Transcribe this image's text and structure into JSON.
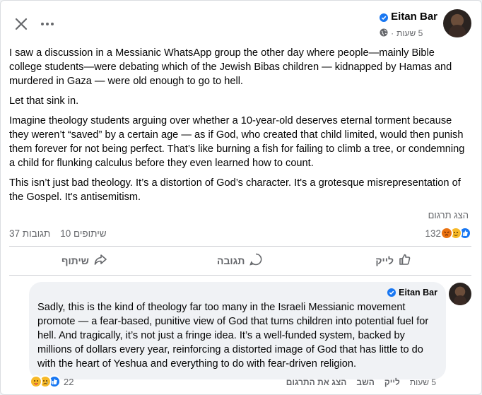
{
  "header": {
    "close_icon": "close-icon",
    "more_icon": "more-horizontal-icon",
    "author_name": "Eitan Bar",
    "time": "5 שעות",
    "separator": "·",
    "audience_icon": "globe-icon"
  },
  "post": {
    "paragraphs": [
      "I saw a discussion in a Messianic WhatsApp group the other day where people—mainly Bible college students—were debating which of the Jewish Bibas children — kidnapped by Hamas and murdered in Gaza — were old enough to go to hell.",
      "Let that sink in.",
      "Imagine theology students arguing over whether a 10-year-old deserves eternal torment because they weren’t “saved” by a certain age — as if God, who created that child limited, would then punish them forever for not being perfect. That’s like burning a fish for failing to climb a tree, or condemning a child for flunking calculus before they even learned how to count.",
      "This isn’t just bad theology. It’s a distortion of God’s character. It's a grotesque misrepresentation of the Gospel. It's antisemitism."
    ],
    "translate_label": "הצג תרגום"
  },
  "stats": {
    "reactions_count": "132",
    "comments": "37 תגובות",
    "shares": "10 שיתופים"
  },
  "actions": {
    "like_label": "לייק",
    "comment_label": "תגובה",
    "share_label": "שיתוף"
  },
  "comment": {
    "author_name": "Eitan Bar",
    "text": "Sadly, this is the kind of theology far too many in the Israeli Messianic movement promote — a fear-based, punitive view of God that turns children into potential fuel for hell. And tragically, it’s not just a fringe idea. It’s a well-funded system, backed by millions of dollars every year, reinforcing a distorted image of God that has little to do with the heart of Yeshua and everything to do with fear-driven religion.",
    "time": "5 שעות",
    "like_label": "לייק",
    "reply_label": "השב",
    "translate_label": "הצג את התרגום",
    "reactions_count": "22"
  },
  "colors": {
    "like_blue": "#1877f2",
    "care_yellow": "#f7b928",
    "angry_orange": "#e9710f",
    "secondary_text": "#65676b"
  }
}
